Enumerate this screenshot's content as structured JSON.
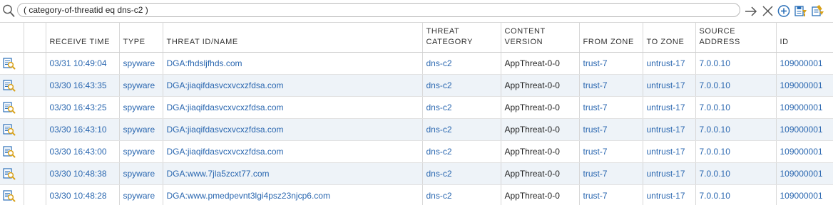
{
  "filter": {
    "query": "( category-of-threatid eq dns-c2 )"
  },
  "toolbar": {
    "icons": [
      "apply-filter-icon",
      "clear-filter-icon",
      "add-filter-icon",
      "save-filter-icon",
      "load-filter-icon"
    ]
  },
  "table": {
    "headers": {
      "receive_time": "RECEIVE TIME",
      "type": "TYPE",
      "threat_name": "THREAT ID/NAME",
      "threat_category": "THREAT CATEGORY",
      "content_version": "CONTENT VERSION",
      "from_zone": "FROM ZONE",
      "to_zone": "TO ZONE",
      "source_address": "SOURCE ADDRESS",
      "id": "ID"
    },
    "rows": [
      {
        "receive_time": "03/31 10:49:04",
        "type": "spyware",
        "threat_name": "DGA:fhdsljfhds.com",
        "threat_category": "dns-c2",
        "content_version": "AppThreat-0-0",
        "from_zone": "trust-7",
        "to_zone": "untrust-17",
        "source_address": "7.0.0.10",
        "id": "109000001"
      },
      {
        "receive_time": "03/30 16:43:35",
        "type": "spyware",
        "threat_name": "DGA:jiaqifdasvcxvcxzfdsa.com",
        "threat_category": "dns-c2",
        "content_version": "AppThreat-0-0",
        "from_zone": "trust-7",
        "to_zone": "untrust-17",
        "source_address": "7.0.0.10",
        "id": "109000001"
      },
      {
        "receive_time": "03/30 16:43:25",
        "type": "spyware",
        "threat_name": "DGA:jiaqifdasvcxvcxzfdsa.com",
        "threat_category": "dns-c2",
        "content_version": "AppThreat-0-0",
        "from_zone": "trust-7",
        "to_zone": "untrust-17",
        "source_address": "7.0.0.10",
        "id": "109000001"
      },
      {
        "receive_time": "03/30 16:43:10",
        "type": "spyware",
        "threat_name": "DGA:jiaqifdasvcxvcxzfdsa.com",
        "threat_category": "dns-c2",
        "content_version": "AppThreat-0-0",
        "from_zone": "trust-7",
        "to_zone": "untrust-17",
        "source_address": "7.0.0.10",
        "id": "109000001"
      },
      {
        "receive_time": "03/30 16:43:00",
        "type": "spyware",
        "threat_name": "DGA:jiaqifdasvcxvcxzfdsa.com",
        "threat_category": "dns-c2",
        "content_version": "AppThreat-0-0",
        "from_zone": "trust-7",
        "to_zone": "untrust-17",
        "source_address": "7.0.0.10",
        "id": "109000001"
      },
      {
        "receive_time": "03/30 10:48:38",
        "type": "spyware",
        "threat_name": "DGA:www.7jla5zcxt77.com",
        "threat_category": "dns-c2",
        "content_version": "AppThreat-0-0",
        "from_zone": "trust-7",
        "to_zone": "untrust-17",
        "source_address": "7.0.0.10",
        "id": "109000001"
      },
      {
        "receive_time": "03/30 10:48:28",
        "type": "spyware",
        "threat_name": "DGA:www.pmedpevnt3lgi4psz23njcp6.com",
        "threat_category": "dns-c2",
        "content_version": "AppThreat-0-0",
        "from_zone": "trust-7",
        "to_zone": "untrust-17",
        "source_address": "7.0.0.10",
        "id": "109000001"
      }
    ]
  },
  "colors": {
    "link": "#2a67b0",
    "alt_row": "#eef3f8",
    "icon_blue": "#2a6fb8",
    "icon_gold": "#d9a21b"
  }
}
